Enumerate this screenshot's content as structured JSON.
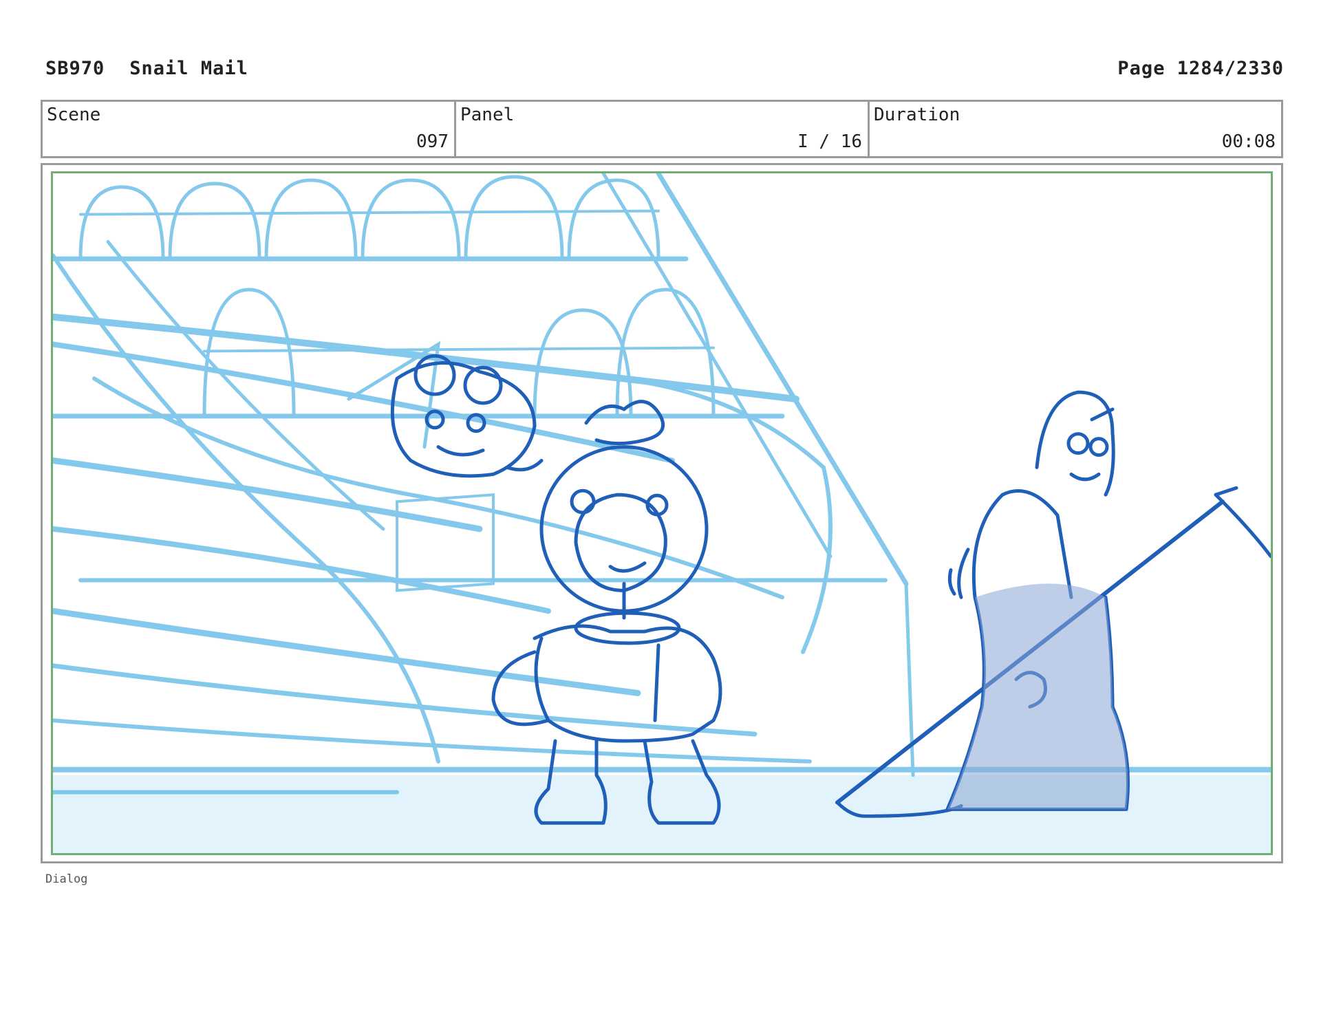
{
  "header": {
    "production_code": "SB970",
    "episode_title": "Snail Mail",
    "page_label": "Page 1284/2330"
  },
  "info_bar": {
    "scene": {
      "label": "Scene",
      "value": "097"
    },
    "panel": {
      "label": "Panel",
      "value": "I / 16"
    },
    "duration": {
      "label": "Duration",
      "value": "00:08"
    }
  },
  "panel_image": {
    "colors": {
      "rough_line": "#5bb8e6",
      "ink_line": "#1f5fb8",
      "robe_fill": "#8aa6d6",
      "floor_fill": "#e3f3fb"
    }
  },
  "dialog": {
    "label": "Dialog"
  }
}
